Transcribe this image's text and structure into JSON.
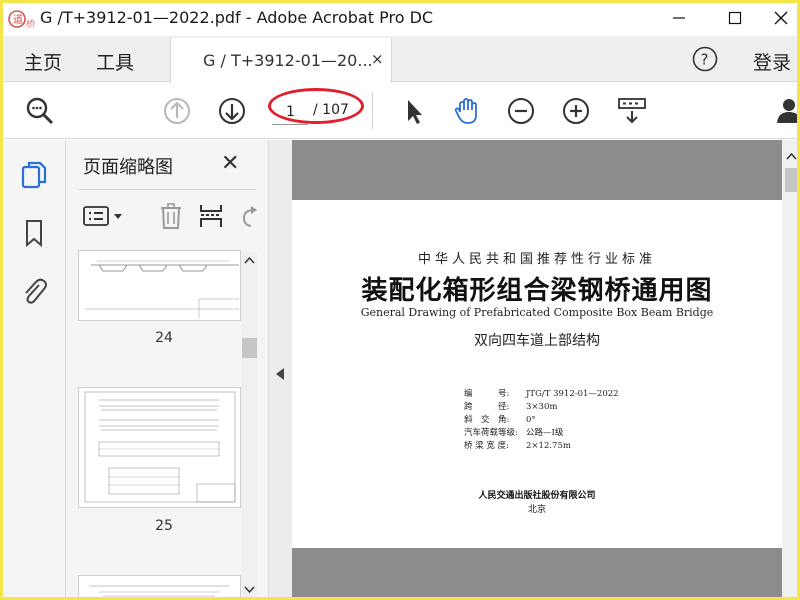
{
  "window": {
    "title": "G /T+3912-01—2022.pdf - Adobe Acrobat Pro DC",
    "logo_text": "道桥网"
  },
  "tabs": {
    "home": "主页",
    "tools": "工具",
    "doc_tab": "G / T+3912-01—20...",
    "doc_tab_close": "×",
    "login": "登录"
  },
  "toolbar": {
    "current_page": "1",
    "total_pages": "/ 107"
  },
  "panel": {
    "title": "页面缩略图",
    "close": "✕",
    "thumbnails": [
      {
        "page": "24"
      },
      {
        "page": "25"
      }
    ]
  },
  "document": {
    "subtitle": "中华人民共和国推荐性行业标准",
    "title": "装配化箱形组合梁钢桥通用图",
    "english_title": "General Drawing of Prefabricated Composite Box Beam Bridge",
    "part": "双向四车道上部结构",
    "info": [
      {
        "key": "编　　　号:",
        "value": "JTG/T 3912-01—2022"
      },
      {
        "key": "跨　　　径:",
        "value": "3×30m"
      },
      {
        "key": "斜　交　角:",
        "value": "0°"
      },
      {
        "key": "汽车荷载等级:",
        "value": "公路—Ⅰ级"
      },
      {
        "key": "桥 梁 宽 度:",
        "value": "2×12.75m"
      }
    ],
    "publisher": "人民交通出版社股份有限公司",
    "city": "北京"
  },
  "colors": {
    "accent_blue": "#2a6fd6",
    "annotation_red": "#e0202a",
    "frame_yellow": "#f2e64a"
  }
}
